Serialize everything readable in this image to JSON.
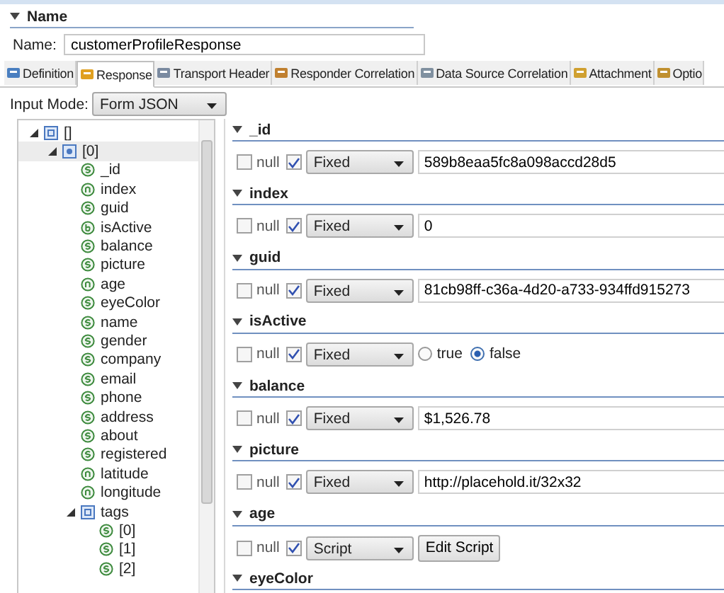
{
  "name_section": {
    "title": "Name",
    "expanded": true
  },
  "name_field": {
    "label": "Name:",
    "value": "customerProfileResponse"
  },
  "tabs": [
    {
      "label": "Definition",
      "selected": false
    },
    {
      "label": "Response",
      "selected": true
    },
    {
      "label": "Transport Header",
      "selected": false
    },
    {
      "label": "Responder Correlation",
      "selected": false
    },
    {
      "label": "Data Source Correlation",
      "selected": false
    },
    {
      "label": "Attachment",
      "selected": false
    },
    {
      "label": "Optio",
      "selected": false
    }
  ],
  "input_mode": {
    "label": "Input Mode:",
    "value": "Form JSON"
  },
  "tree": [
    {
      "label": "[]",
      "kind": "array",
      "expanded": true,
      "selected": false,
      "children": [
        {
          "label": "[0]",
          "kind": "object",
          "expanded": true,
          "selected": true,
          "children": [
            {
              "label": "_id",
              "kind": "string",
              "selected": false
            },
            {
              "label": "index",
              "kind": "number",
              "selected": false
            },
            {
              "label": "guid",
              "kind": "string",
              "selected": false
            },
            {
              "label": "isActive",
              "kind": "boolean",
              "selected": false
            },
            {
              "label": "balance",
              "kind": "string",
              "selected": false
            },
            {
              "label": "picture",
              "kind": "string",
              "selected": false
            },
            {
              "label": "age",
              "kind": "number",
              "selected": false
            },
            {
              "label": "eyeColor",
              "kind": "string",
              "selected": false
            },
            {
              "label": "name",
              "kind": "string",
              "selected": false
            },
            {
              "label": "gender",
              "kind": "string",
              "selected": false
            },
            {
              "label": "company",
              "kind": "string",
              "selected": false
            },
            {
              "label": "email",
              "kind": "string",
              "selected": false
            },
            {
              "label": "phone",
              "kind": "string",
              "selected": false
            },
            {
              "label": "address",
              "kind": "string",
              "selected": false
            },
            {
              "label": "about",
              "kind": "string",
              "selected": false
            },
            {
              "label": "registered",
              "kind": "string",
              "selected": false
            },
            {
              "label": "latitude",
              "kind": "number",
              "selected": false
            },
            {
              "label": "longitude",
              "kind": "number",
              "selected": false
            },
            {
              "label": "tags",
              "kind": "array",
              "expanded": true,
              "selected": false,
              "children": [
                {
                  "label": "[0]",
                  "kind": "string",
                  "selected": false
                },
                {
                  "label": "[1]",
                  "kind": "string",
                  "selected": false
                },
                {
                  "label": "[2]",
                  "kind": "string",
                  "selected": false
                }
              ]
            }
          ]
        }
      ]
    }
  ],
  "fields": [
    {
      "name": "_id",
      "expanded": true,
      "kind": "text",
      "null_label": "null",
      "null": false,
      "enabled": true,
      "mode": "Fixed",
      "value": "589b8eaa5fc8a098accd28d5"
    },
    {
      "name": "index",
      "expanded": true,
      "kind": "text",
      "null_label": "null",
      "null": false,
      "enabled": true,
      "mode": "Fixed",
      "value": "0"
    },
    {
      "name": "guid",
      "expanded": true,
      "kind": "text",
      "null_label": "null",
      "null": false,
      "enabled": true,
      "mode": "Fixed",
      "value": "81cb98ff-c36a-4d20-a733-934ffd915273"
    },
    {
      "name": "isActive",
      "expanded": true,
      "kind": "boolean",
      "null_label": "null",
      "null": false,
      "enabled": true,
      "mode": "Fixed",
      "options": [
        {
          "label": "true",
          "selected": false
        },
        {
          "label": "false",
          "selected": true
        }
      ]
    },
    {
      "name": "balance",
      "expanded": true,
      "kind": "text",
      "null_label": "null",
      "null": false,
      "enabled": true,
      "mode": "Fixed",
      "value": "$1,526.78"
    },
    {
      "name": "picture",
      "expanded": true,
      "kind": "text",
      "null_label": "null",
      "null": false,
      "enabled": true,
      "mode": "Fixed",
      "value": "http://placehold.it/32x32"
    },
    {
      "name": "age",
      "expanded": true,
      "kind": "script",
      "null_label": "null",
      "null": false,
      "enabled": true,
      "mode": "Script",
      "button": "Edit Script"
    },
    {
      "name": "eyeColor",
      "expanded": true
    }
  ]
}
